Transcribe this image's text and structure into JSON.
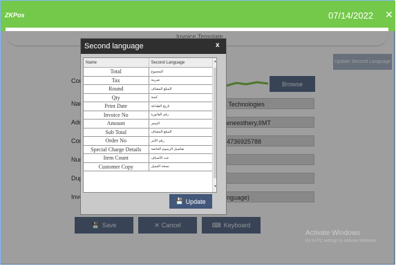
{
  "app": {
    "logo_text": "ZKPos",
    "date": "07/14/2022",
    "close_glyph": "✕"
  },
  "sheet": {
    "title": "Invoice Template"
  },
  "form": {
    "labels": [
      "Cor",
      "Nam",
      "Add",
      "Con",
      "Nun",
      "Dup",
      "Invo"
    ],
    "update_second_language": "Update Second Language",
    "browse": "Browse",
    "company_name": "a Technologies",
    "address": "lameesthery,IIMT",
    "contact": "74736925788",
    "invoice_language": "anguage)",
    "save": "Save",
    "cancel": "Cancel",
    "keyboard": "Keyboard"
  },
  "dialog": {
    "title": "Second language",
    "close_glyph": "x",
    "columns": [
      "Name",
      "Second Language"
    ],
    "rows": [
      {
        "name": "Total",
        "second": "المجموع"
      },
      {
        "name": "Tax",
        "second": "ضريبة"
      },
      {
        "name": "Round",
        "second": "المبلغ المضاف"
      },
      {
        "name": "Qty",
        "second": "كمية"
      },
      {
        "name": "Print Date",
        "second": "تاريخ الطباعة"
      },
      {
        "name": "Invoice No",
        "second": "رقم الفاتورة"
      },
      {
        "name": "Amount",
        "second": "السعر"
      },
      {
        "name": "Sub Total",
        "second": "المبلغ المضاف"
      },
      {
        "name": "Order No",
        "second": "رقم الأمر"
      },
      {
        "name": "Special Charge Details",
        "second": "تفاصيل الرسوم الخاصة"
      },
      {
        "name": "Item Count",
        "second": "عدد الأصناف"
      },
      {
        "name": "Customer Copy",
        "second": "نسخة العميل"
      }
    ],
    "update": "Update"
  },
  "watermark": {
    "line1": "Activate Windows",
    "line2": "Go to PC settings to activate Windows."
  },
  "colors": {
    "topbar": "#74c84a",
    "button": "#5b6e8c",
    "dialog_title": "#2f2f2f"
  }
}
